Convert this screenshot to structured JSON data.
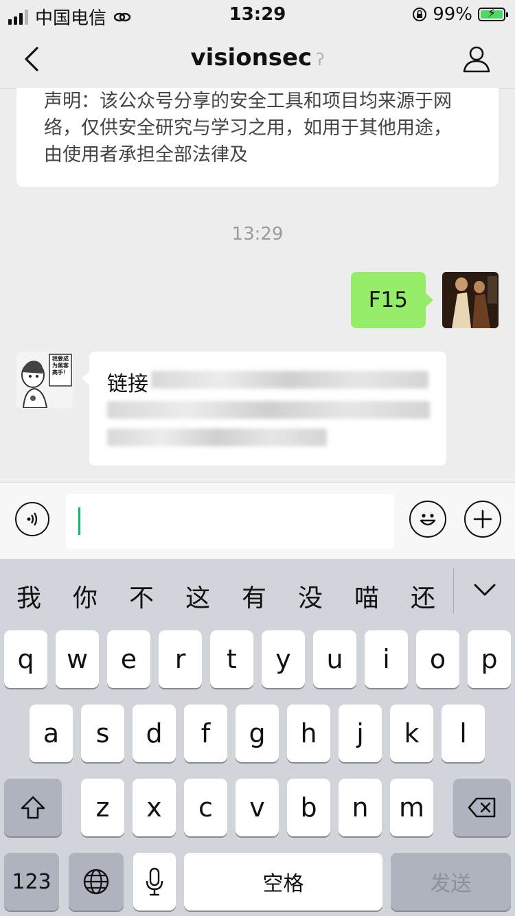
{
  "status_bar": {
    "carrier": "中国电信",
    "time": "13:29",
    "battery_percent": "99%",
    "battery_level": 0.99,
    "signal_bars": 3
  },
  "nav": {
    "title": "visionsec",
    "back_icon": "chevron-left-icon",
    "profile_icon": "person-icon",
    "muted_icon": "ear-icon"
  },
  "chat": {
    "article_text": "声明：该公众号分享的安全工具和项目均来源于网络，仅供安全研究与学习之用，如用于其他用途，由使用者承担全部法律及",
    "timestamp": "13:29",
    "sent_message": "F15",
    "received_label": "链接",
    "avatar_text": "我要成为黑客高手！",
    "sent_bubble_color": "#95ec69"
  },
  "input_bar": {
    "voice_icon": "voice-icon",
    "emoji_icon": "emoji-icon",
    "plus_icon": "plus-icon",
    "cursor_color": "#07c160"
  },
  "keyboard": {
    "candidates": [
      "我",
      "你",
      "不",
      "这",
      "有",
      "没",
      "喵",
      "还"
    ],
    "row1": [
      "q",
      "w",
      "e",
      "r",
      "t",
      "y",
      "u",
      "i",
      "o",
      "p"
    ],
    "row2": [
      "a",
      "s",
      "d",
      "f",
      "g",
      "h",
      "j",
      "k",
      "l"
    ],
    "row3": [
      "z",
      "x",
      "c",
      "v",
      "b",
      "n",
      "m"
    ],
    "shift_icon": "shift-icon",
    "delete_icon": "backspace-icon",
    "numbers_label": "123",
    "globe_icon": "globe-icon",
    "mic_icon": "microphone-icon",
    "space_label": "空格",
    "send_label": "发送"
  }
}
